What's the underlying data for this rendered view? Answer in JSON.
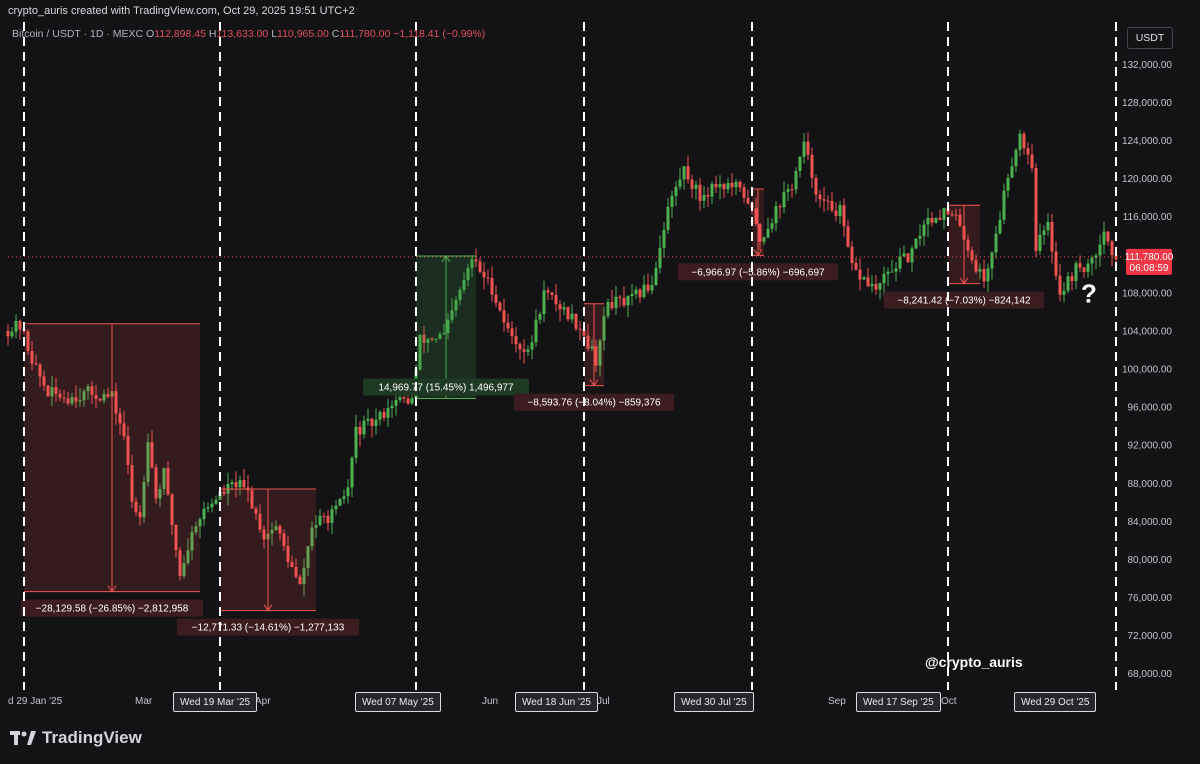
{
  "header": {
    "credit": "crypto_auris created with TradingView.com, Oct 29, 2025 19:51 UTC+2",
    "symbol": "Bitcoin / USDT · 1D · MEXC",
    "o_label": "O",
    "o_value": "112,898.45",
    "h_label": "H",
    "h_value": "113,633.00",
    "l_label": "L",
    "l_value": "110,965.00",
    "c_label": "C",
    "c_value": "111,780.00",
    "change": "−1,118.41 (−0.99%)"
  },
  "currency_button": "USDT",
  "watermark_handle": "@crypto_auris",
  "logo_text": "TradingView",
  "question_mark": "?",
  "current_price": {
    "value": "111,780.00",
    "countdown": "06:08:59"
  },
  "x_axis": {
    "first_label": "d 29 Jan '25",
    "months": [
      "Mar",
      "Apr",
      "Jun",
      "Jul",
      "Sep",
      "Oct"
    ],
    "highlighted_dates": [
      "Wed 19 Mar '25",
      "Wed 07 May '25",
      "Wed 18 Jun '25",
      "Wed 30 Jul '25",
      "Wed 17 Sep '25",
      "Wed 29 Oct '25"
    ]
  },
  "colors": {
    "up": "#26a69a",
    "up_candle": "#4caf50",
    "down": "#ef5350",
    "bg": "#131316",
    "text": "#b2b5be"
  },
  "chart_data": {
    "type": "candlestick",
    "series_name": "Bitcoin / USDT",
    "y_axis": {
      "ticks": [
        132000,
        128000,
        124000,
        120000,
        116000,
        112000,
        108000,
        104000,
        100000,
        96000,
        92000,
        88000,
        84000,
        80000,
        76000,
        72000,
        68000
      ],
      "tick_labels": [
        "132,000.00",
        "128,000.00",
        "124,000.00",
        "120,000.00",
        "116,000.00",
        "108,000.00",
        "104,000.00",
        "100,000.00",
        "96,000.00",
        "92,000.00",
        "88,000.00",
        "84,000.00",
        "80,000.00",
        "76,000.00",
        "72,000.00",
        "68,000.00"
      ],
      "ylim": [
        66500,
        133500
      ]
    },
    "x_range": [
      "2025-01-25",
      "2025-10-31"
    ],
    "price_path": [
      [
        "2025-01-25",
        104000
      ],
      [
        "2025-01-29",
        104500
      ],
      [
        "2025-02-02",
        100000
      ],
      [
        "2025-02-05",
        97500
      ],
      [
        "2025-02-10",
        97000
      ],
      [
        "2025-02-15",
        97500
      ],
      [
        "2025-02-21",
        97000
      ],
      [
        "2025-02-24",
        93000
      ],
      [
        "2025-02-26",
        86000
      ],
      [
        "2025-02-28",
        84500
      ],
      [
        "2025-03-02",
        93000
      ],
      [
        "2025-03-04",
        86500
      ],
      [
        "2025-03-06",
        89000
      ],
      [
        "2025-03-10",
        78500
      ],
      [
        "2025-03-14",
        84000
      ],
      [
        "2025-03-19",
        86500
      ],
      [
        "2025-03-24",
        88000
      ],
      [
        "2025-03-27",
        87000
      ],
      [
        "2025-03-31",
        82500
      ],
      [
        "2025-04-03",
        83500
      ],
      [
        "2025-04-07",
        79000
      ],
      [
        "2025-04-09",
        77000
      ],
      [
        "2025-04-12",
        83500
      ],
      [
        "2025-04-18",
        85000
      ],
      [
        "2025-04-21",
        87500
      ],
      [
        "2025-04-23",
        93500
      ],
      [
        "2025-04-28",
        94500
      ],
      [
        "2025-05-02",
        96500
      ],
      [
        "2025-05-07",
        96800
      ],
      [
        "2025-05-09",
        103000
      ],
      [
        "2025-05-15",
        103500
      ],
      [
        "2025-05-22",
        111500
      ],
      [
        "2025-05-27",
        108500
      ],
      [
        "2025-05-31",
        104000
      ],
      [
        "2025-06-05",
        101500
      ],
      [
        "2025-06-09",
        108000
      ],
      [
        "2025-06-12",
        107000
      ],
      [
        "2025-06-18",
        104500
      ],
      [
        "2025-06-22",
        101000
      ],
      [
        "2025-06-25",
        107000
      ],
      [
        "2025-06-30",
        107000
      ],
      [
        "2025-07-06",
        109000
      ],
      [
        "2025-07-10",
        117000
      ],
      [
        "2025-07-14",
        121000
      ],
      [
        "2025-07-18",
        118000
      ],
      [
        "2025-07-22",
        119500
      ],
      [
        "2025-07-27",
        119000
      ],
      [
        "2025-07-30",
        117800
      ],
      [
        "2025-08-02",
        113500
      ],
      [
        "2025-08-07",
        117500
      ],
      [
        "2025-08-10",
        119300
      ],
      [
        "2025-08-13",
        123400
      ],
      [
        "2025-08-17",
        117500
      ],
      [
        "2025-08-22",
        116500
      ],
      [
        "2025-08-25",
        110500
      ],
      [
        "2025-08-31",
        108300
      ],
      [
        "2025-09-05",
        111000
      ],
      [
        "2025-09-09",
        112000
      ],
      [
        "2025-09-12",
        115500
      ],
      [
        "2025-09-17",
        116500
      ],
      [
        "2025-09-21",
        115300
      ],
      [
        "2025-09-24",
        111500
      ],
      [
        "2025-09-27",
        109300
      ],
      [
        "2025-09-30",
        114000
      ],
      [
        "2025-10-03",
        120500
      ],
      [
        "2025-10-06",
        124700
      ],
      [
        "2025-10-09",
        121500
      ],
      [
        "2025-10-10",
        113000
      ],
      [
        "2025-10-13",
        115000
      ],
      [
        "2025-10-16",
        108000
      ],
      [
        "2025-10-20",
        110500
      ],
      [
        "2025-10-24",
        111000
      ],
      [
        "2025-10-27",
        115000
      ],
      [
        "2025-10-29",
        111780
      ]
    ],
    "vertical_lines": [
      "2025-01-29",
      "2025-03-19",
      "2025-05-07",
      "2025-06-18",
      "2025-07-30",
      "2025-09-17",
      "2025-10-29"
    ],
    "measurements": [
      {
        "label": "−28,129.58 (−26.85%) −2,812,958",
        "kind": "down",
        "from_date": "2025-01-29",
        "to_date": "2025-03-14",
        "from_price": 104750,
        "to_price": 76620
      },
      {
        "label": "−12,771.33 (−14.61%) −1,277,133",
        "kind": "down",
        "from_date": "2025-03-19",
        "to_date": "2025-04-12",
        "from_price": 87400,
        "to_price": 74630
      },
      {
        "label": "14,969.77 (15.45%) 1,496,977",
        "kind": "up",
        "from_date": "2025-05-07",
        "to_date": "2025-05-22",
        "from_price": 96900,
        "to_price": 111870
      },
      {
        "label": "−8,593.76 (−8.04%) −859,376",
        "kind": "down",
        "from_date": "2025-06-18",
        "to_date": "2025-06-23",
        "from_price": 106850,
        "to_price": 98260
      },
      {
        "label": "−6,966.97 (−5.86%) −696,697",
        "kind": "down",
        "from_date": "2025-07-30",
        "to_date": "2025-08-02",
        "from_price": 118900,
        "to_price": 111930
      },
      {
        "label": "−8,241.42 (−7.03%) −824,142",
        "kind": "down",
        "from_date": "2025-09-17",
        "to_date": "2025-09-25",
        "from_price": 117200,
        "to_price": 108960
      }
    ]
  }
}
